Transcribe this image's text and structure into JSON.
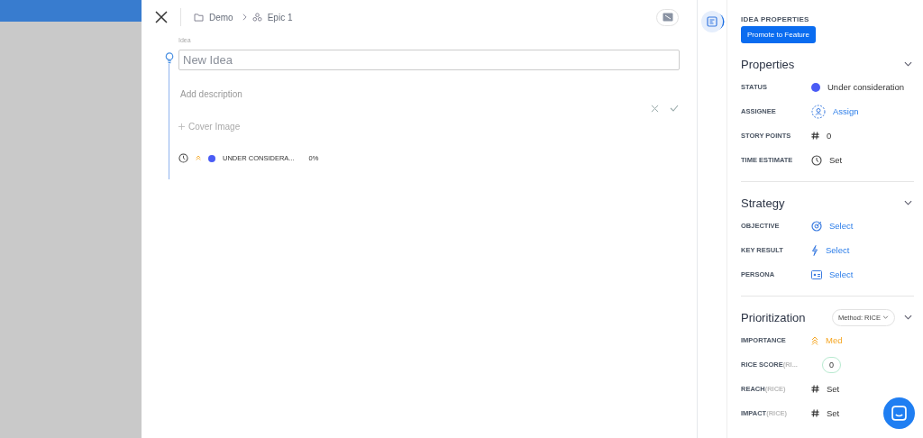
{
  "breadcrumb": [
    {
      "kind": "folder",
      "label": "Demo"
    },
    {
      "kind": "epic",
      "label": "Epic 1"
    }
  ],
  "idea": {
    "label": "Idea",
    "placeholder": "New Idea",
    "description_placeholder": "Add description",
    "cover_image": "Cover Image"
  },
  "summary": {
    "status": "UNDER CONSIDERA...",
    "color": "#4a5cf5",
    "progress": "0%"
  },
  "panel": {
    "heading": "IDEA PROPERTIES",
    "promote": "Promote to Feature",
    "sections": [
      {
        "title": "Properties",
        "expanded": true,
        "rows": [
          {
            "label": "STATUS",
            "kind": "status",
            "value": "Under consideration",
            "color": "#4a5cf5"
          },
          {
            "label": "ASSIGNEE",
            "kind": "assign",
            "value": "Assign"
          },
          {
            "label": "STORY POINTS",
            "kind": "number",
            "value": "0"
          },
          {
            "label": "TIME ESTIMATE",
            "kind": "time",
            "value": "Set"
          }
        ]
      },
      {
        "title": "Strategy",
        "expanded": true,
        "rows": [
          {
            "label": "OBJECTIVE",
            "kind": "objective",
            "value": "Select"
          },
          {
            "label": "KEY RESULT",
            "kind": "keyresult",
            "value": "Select"
          },
          {
            "label": "PERSONA",
            "kind": "persona",
            "value": "Select"
          }
        ]
      },
      {
        "title": "Prioritization",
        "expanded": true,
        "method": "Method: RICE",
        "rows": [
          {
            "label": "IMPORTANCE",
            "kind": "importance",
            "value": "Med"
          },
          {
            "label": "RICE SCORE",
            "sublabel": "(RI...",
            "kind": "score",
            "value": "0"
          },
          {
            "label": "REACH",
            "sublabel": "(RICE)",
            "kind": "number",
            "value": "Set"
          },
          {
            "label": "IMPACT",
            "sublabel": "(RICE)",
            "kind": "number",
            "value": "Set"
          }
        ]
      }
    ]
  }
}
